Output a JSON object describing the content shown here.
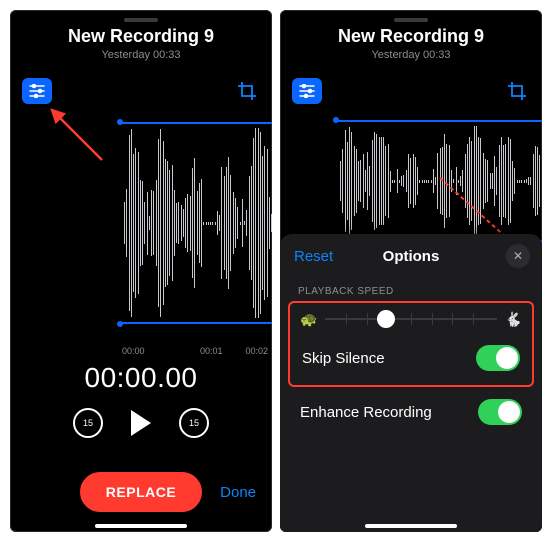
{
  "recording": {
    "title": "New Recording 9",
    "subtitle": "Yesterday   00:33"
  },
  "timeline": {
    "ticks": [
      "00:00",
      "00:01",
      "00:02"
    ]
  },
  "playback": {
    "current_time": "00:00.00",
    "skip_seconds": "15"
  },
  "buttons": {
    "replace": "REPLACE",
    "done": "Done"
  },
  "options": {
    "reset": "Reset",
    "title": "Options",
    "section_playback_speed": "PLAYBACK SPEED",
    "skip_silence_label": "Skip Silence",
    "enhance_label": "Enhance Recording",
    "skip_silence_on": true,
    "enhance_on": true
  },
  "icons": {
    "slow": "🐢",
    "fast": "🐇",
    "close": "✕"
  }
}
